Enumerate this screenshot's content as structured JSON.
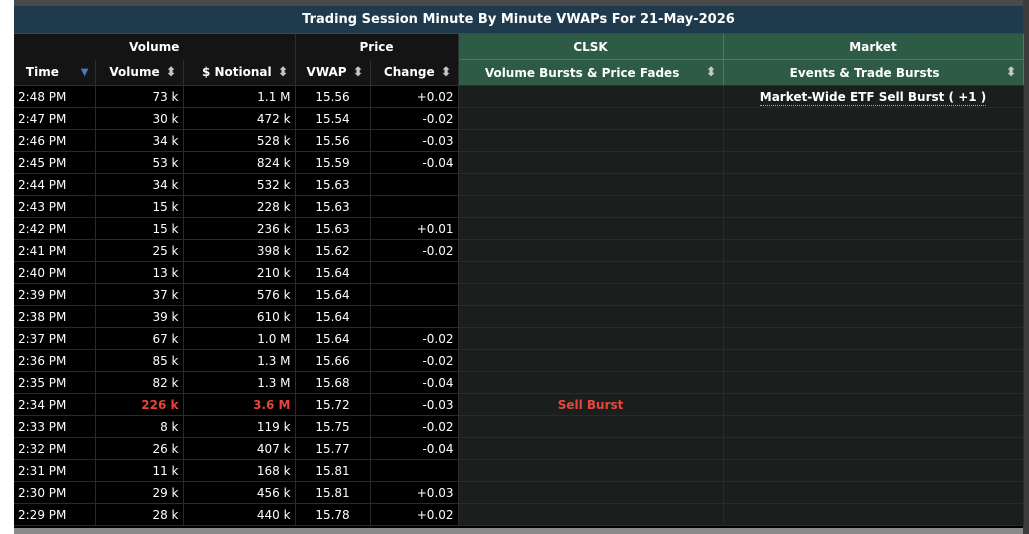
{
  "title": "Trading Session Minute By Minute VWAPs For 21-May-2026",
  "groups": {
    "volume": "Volume",
    "price": "Price",
    "clsk": "CLSK",
    "market": "Market"
  },
  "columns": {
    "time": "Time",
    "volume": "Volume",
    "notional": "$ Notional",
    "vwap": "VWAP",
    "change": "Change",
    "bursts": "Volume Bursts & Price Fades",
    "events": "Events & Trade Bursts"
  },
  "rows": [
    {
      "time": "2:48 PM",
      "volume": "73 k",
      "notional": "1.1 M",
      "vwap": "15.56",
      "change": "+0.02",
      "burst": "",
      "event": "Market-Wide ETF Sell Burst ( +1 )",
      "highlight": false
    },
    {
      "time": "2:47 PM",
      "volume": "30 k",
      "notional": "472 k",
      "vwap": "15.54",
      "change": "-0.02",
      "burst": "",
      "event": "",
      "highlight": false
    },
    {
      "time": "2:46 PM",
      "volume": "34 k",
      "notional": "528 k",
      "vwap": "15.56",
      "change": "-0.03",
      "burst": "",
      "event": "",
      "highlight": false
    },
    {
      "time": "2:45 PM",
      "volume": "53 k",
      "notional": "824 k",
      "vwap": "15.59",
      "change": "-0.04",
      "burst": "",
      "event": "",
      "highlight": false
    },
    {
      "time": "2:44 PM",
      "volume": "34 k",
      "notional": "532 k",
      "vwap": "15.63",
      "change": "",
      "burst": "",
      "event": "",
      "highlight": false
    },
    {
      "time": "2:43 PM",
      "volume": "15 k",
      "notional": "228 k",
      "vwap": "15.63",
      "change": "",
      "burst": "",
      "event": "",
      "highlight": false
    },
    {
      "time": "2:42 PM",
      "volume": "15 k",
      "notional": "236 k",
      "vwap": "15.63",
      "change": "+0.01",
      "burst": "",
      "event": "",
      "highlight": false
    },
    {
      "time": "2:41 PM",
      "volume": "25 k",
      "notional": "398 k",
      "vwap": "15.62",
      "change": "-0.02",
      "burst": "",
      "event": "",
      "highlight": false
    },
    {
      "time": "2:40 PM",
      "volume": "13 k",
      "notional": "210 k",
      "vwap": "15.64",
      "change": "",
      "burst": "",
      "event": "",
      "highlight": false
    },
    {
      "time": "2:39 PM",
      "volume": "37 k",
      "notional": "576 k",
      "vwap": "15.64",
      "change": "",
      "burst": "",
      "event": "",
      "highlight": false
    },
    {
      "time": "2:38 PM",
      "volume": "39 k",
      "notional": "610 k",
      "vwap": "15.64",
      "change": "",
      "burst": "",
      "event": "",
      "highlight": false
    },
    {
      "time": "2:37 PM",
      "volume": "67 k",
      "notional": "1.0 M",
      "vwap": "15.64",
      "change": "-0.02",
      "burst": "",
      "event": "",
      "highlight": false
    },
    {
      "time": "2:36 PM",
      "volume": "85 k",
      "notional": "1.3 M",
      "vwap": "15.66",
      "change": "-0.02",
      "burst": "",
      "event": "",
      "highlight": false
    },
    {
      "time": "2:35 PM",
      "volume": "82 k",
      "notional": "1.3 M",
      "vwap": "15.68",
      "change": "-0.04",
      "burst": "",
      "event": "",
      "highlight": false
    },
    {
      "time": "2:34 PM",
      "volume": "226 k",
      "notional": "3.6 M",
      "vwap": "15.72",
      "change": "-0.03",
      "burst": "Sell Burst",
      "event": "",
      "highlight": true
    },
    {
      "time": "2:33 PM",
      "volume": "8 k",
      "notional": "119 k",
      "vwap": "15.75",
      "change": "-0.02",
      "burst": "",
      "event": "",
      "highlight": false
    },
    {
      "time": "2:32 PM",
      "volume": "26 k",
      "notional": "407 k",
      "vwap": "15.77",
      "change": "-0.04",
      "burst": "",
      "event": "",
      "highlight": false
    },
    {
      "time": "2:31 PM",
      "volume": "11 k",
      "notional": "168 k",
      "vwap": "15.81",
      "change": "",
      "burst": "",
      "event": "",
      "highlight": false
    },
    {
      "time": "2:30 PM",
      "volume": "29 k",
      "notional": "456 k",
      "vwap": "15.81",
      "change": "+0.03",
      "burst": "",
      "event": "",
      "highlight": false
    },
    {
      "time": "2:29 PM",
      "volume": "28 k",
      "notional": "440 k",
      "vwap": "15.78",
      "change": "+0.02",
      "burst": "",
      "event": "",
      "highlight": false
    }
  ],
  "colors": {
    "title_bg": "#1f3a4c",
    "green_header": "#2d5b45",
    "highlight_red": "#e8453a",
    "sort_active": "#4a78c8"
  }
}
